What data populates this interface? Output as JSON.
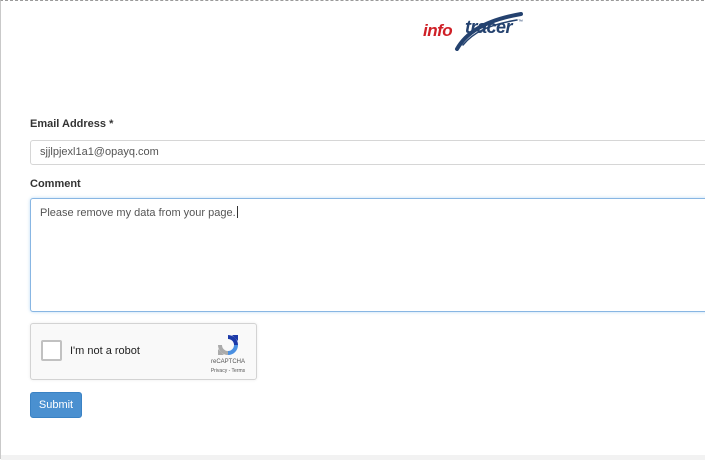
{
  "logo": {
    "part1": "info",
    "part2": "tracer",
    "trademark": "™"
  },
  "form": {
    "email": {
      "label": "Email Address",
      "required_marker": "*",
      "value": "sjjlpjexl1a1@opayq.com"
    },
    "comment": {
      "label": "Comment",
      "value": "Please remove my data from your page."
    },
    "recaptcha": {
      "checkbox_label": "I'm not a robot",
      "brand": "reCAPTCHA",
      "links": "Privacy - Terms"
    },
    "submit_label": "Submit"
  },
  "colors": {
    "logo_red": "#cf2027",
    "logo_navy": "#24426f",
    "button_blue": "#4a90d0",
    "focus_blue": "#88b6e3"
  }
}
